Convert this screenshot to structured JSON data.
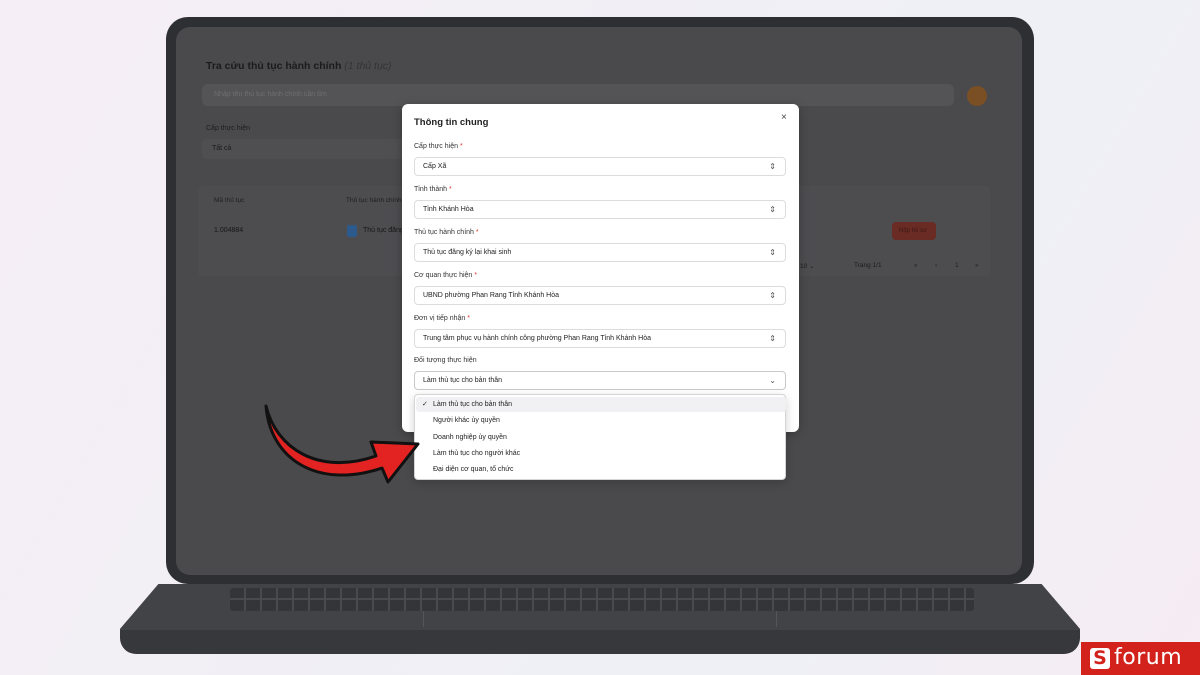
{
  "background_page": {
    "title": "Tra cứu thủ tục hành chính",
    "count": "(1 thủ tục)",
    "search_placeholder": "Nhập tên thủ tục hành chính cần tìm",
    "level_label": "Cấp thực hiện",
    "level_value": "Tất cả",
    "table": {
      "headers": [
        "Mã thủ tục",
        "Thủ tục hành chính"
      ],
      "rows": [
        {
          "code": "1.004884",
          "name": "Thủ tục đăng",
          "action": "Nộp hồ sơ"
        }
      ]
    },
    "pagination": {
      "size": "10",
      "page_label": "Trang 1/1",
      "nav": [
        "«",
        "‹",
        "1",
        "›",
        "»"
      ]
    }
  },
  "modal": {
    "title": "Thông tin chung",
    "close_symbol": "×",
    "fields": [
      {
        "label": "Cấp thực hiện",
        "required": true,
        "value": "Cấp Xã"
      },
      {
        "label": "Tỉnh thành",
        "required": true,
        "value": "Tỉnh Khánh Hòa"
      },
      {
        "label": "Thủ tục hành chính",
        "required": true,
        "value": "Thủ tục đăng ký lại khai sinh"
      },
      {
        "label": "Cơ quan thực hiện",
        "required": true,
        "value": "UBND phường Phan Rang Tỉnh Khánh Hòa"
      },
      {
        "label": "Đơn vị tiếp nhận",
        "required": true,
        "value": "Trung tâm phục vụ hành chính công phường Phan Rang Tỉnh Khánh Hòa"
      },
      {
        "label": "Đối tượng thực hiện",
        "required": false,
        "value": "Làm thủ tục cho bản thân"
      }
    ],
    "required_mark": "*",
    "dropdown": {
      "selected_index": 0,
      "check_symbol": "✓",
      "options": [
        "Làm thủ tục cho bản thân",
        "Người khác ủy quyền",
        "Doanh nghiệp ủy quyền",
        "Làm thủ tục cho người khác",
        "Đại diện cơ quan, tổ chức"
      ]
    }
  },
  "brand": {
    "letter": "S",
    "text": "forum",
    "color": "#d3221b"
  },
  "icons": {
    "select": "up-down-chevron-icon",
    "open_select": "chevron-down-icon",
    "arrow": "red-curved-arrow-icon"
  }
}
